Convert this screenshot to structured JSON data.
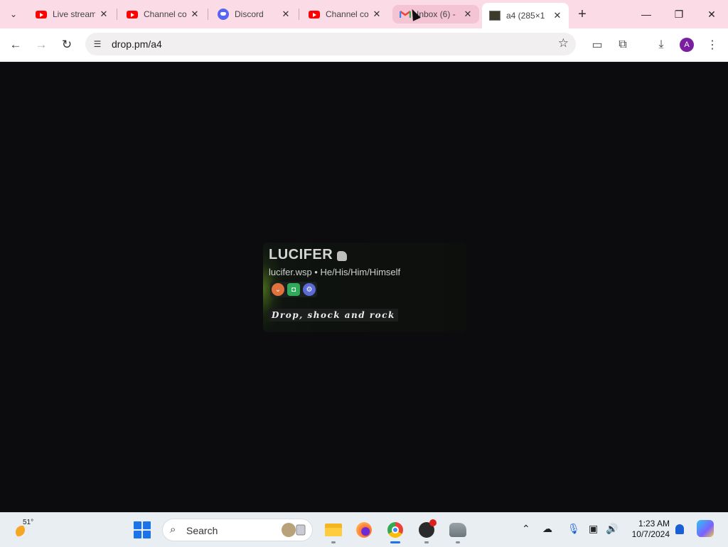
{
  "browser": {
    "tabs": [
      {
        "title": "Live stream",
        "icon": "youtube-icon"
      },
      {
        "title": "Channel content",
        "icon": "youtube-icon"
      },
      {
        "title": "Discord",
        "icon": "discord-icon"
      },
      {
        "title": "Channel content",
        "icon": "youtube-icon"
      },
      {
        "title": "Inbox (6) -",
        "icon": "gmail-icon"
      },
      {
        "title": "a4 (285×1",
        "icon": "image-thumbnail-icon"
      }
    ],
    "active_tab_index": 5,
    "hovered_tab_index": 4,
    "url": "drop.pm/a4",
    "profile_initial": "A"
  },
  "profile_card": {
    "name": "LUCIFER",
    "handle_line": "lucifer.wsp • He/His/Him/Himself",
    "tagline": "Drop, shock and rock",
    "badges": [
      "orange-chevron-badge",
      "green-badge",
      "gear-badge"
    ]
  },
  "taskbar": {
    "temperature": "51°",
    "search_label": "Search",
    "time": "1:23 AM",
    "date": "10/7/2024"
  },
  "colors": {
    "tabstrip": "#fadbe6",
    "accent": "#1a73e8",
    "page_background": "#0c0c0e"
  }
}
